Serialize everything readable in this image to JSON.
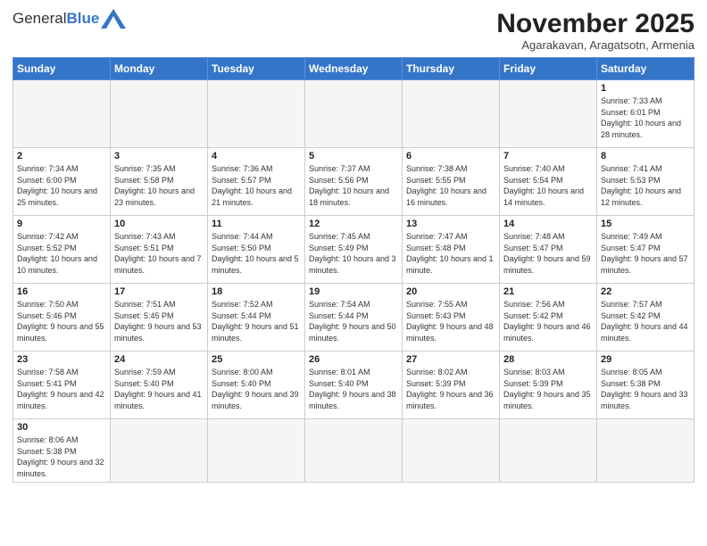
{
  "header": {
    "logo_general": "General",
    "logo_blue": "Blue",
    "month_title": "November 2025",
    "subtitle": "Agarakavan, Aragatsotn, Armenia"
  },
  "days_of_week": [
    "Sunday",
    "Monday",
    "Tuesday",
    "Wednesday",
    "Thursday",
    "Friday",
    "Saturday"
  ],
  "weeks": [
    [
      {
        "day": null,
        "info": null
      },
      {
        "day": null,
        "info": null
      },
      {
        "day": null,
        "info": null
      },
      {
        "day": null,
        "info": null
      },
      {
        "day": null,
        "info": null
      },
      {
        "day": null,
        "info": null
      },
      {
        "day": "1",
        "info": "Sunrise: 7:33 AM\nSunset: 6:01 PM\nDaylight: 10 hours\nand 28 minutes."
      }
    ],
    [
      {
        "day": "2",
        "info": "Sunrise: 7:34 AM\nSunset: 6:00 PM\nDaylight: 10 hours\nand 25 minutes."
      },
      {
        "day": "3",
        "info": "Sunrise: 7:35 AM\nSunset: 5:58 PM\nDaylight: 10 hours\nand 23 minutes."
      },
      {
        "day": "4",
        "info": "Sunrise: 7:36 AM\nSunset: 5:57 PM\nDaylight: 10 hours\nand 21 minutes."
      },
      {
        "day": "5",
        "info": "Sunrise: 7:37 AM\nSunset: 5:56 PM\nDaylight: 10 hours\nand 18 minutes."
      },
      {
        "day": "6",
        "info": "Sunrise: 7:38 AM\nSunset: 5:55 PM\nDaylight: 10 hours\nand 16 minutes."
      },
      {
        "day": "7",
        "info": "Sunrise: 7:40 AM\nSunset: 5:54 PM\nDaylight: 10 hours\nand 14 minutes."
      },
      {
        "day": "8",
        "info": "Sunrise: 7:41 AM\nSunset: 5:53 PM\nDaylight: 10 hours\nand 12 minutes."
      }
    ],
    [
      {
        "day": "9",
        "info": "Sunrise: 7:42 AM\nSunset: 5:52 PM\nDaylight: 10 hours\nand 10 minutes."
      },
      {
        "day": "10",
        "info": "Sunrise: 7:43 AM\nSunset: 5:51 PM\nDaylight: 10 hours\nand 7 minutes."
      },
      {
        "day": "11",
        "info": "Sunrise: 7:44 AM\nSunset: 5:50 PM\nDaylight: 10 hours\nand 5 minutes."
      },
      {
        "day": "12",
        "info": "Sunrise: 7:45 AM\nSunset: 5:49 PM\nDaylight: 10 hours\nand 3 minutes."
      },
      {
        "day": "13",
        "info": "Sunrise: 7:47 AM\nSunset: 5:48 PM\nDaylight: 10 hours\nand 1 minute."
      },
      {
        "day": "14",
        "info": "Sunrise: 7:48 AM\nSunset: 5:47 PM\nDaylight: 9 hours\nand 59 minutes."
      },
      {
        "day": "15",
        "info": "Sunrise: 7:49 AM\nSunset: 5:47 PM\nDaylight: 9 hours\nand 57 minutes."
      }
    ],
    [
      {
        "day": "16",
        "info": "Sunrise: 7:50 AM\nSunset: 5:46 PM\nDaylight: 9 hours\nand 55 minutes."
      },
      {
        "day": "17",
        "info": "Sunrise: 7:51 AM\nSunset: 5:45 PM\nDaylight: 9 hours\nand 53 minutes."
      },
      {
        "day": "18",
        "info": "Sunrise: 7:52 AM\nSunset: 5:44 PM\nDaylight: 9 hours\nand 51 minutes."
      },
      {
        "day": "19",
        "info": "Sunrise: 7:54 AM\nSunset: 5:44 PM\nDaylight: 9 hours\nand 50 minutes."
      },
      {
        "day": "20",
        "info": "Sunrise: 7:55 AM\nSunset: 5:43 PM\nDaylight: 9 hours\nand 48 minutes."
      },
      {
        "day": "21",
        "info": "Sunrise: 7:56 AM\nSunset: 5:42 PM\nDaylight: 9 hours\nand 46 minutes."
      },
      {
        "day": "22",
        "info": "Sunrise: 7:57 AM\nSunset: 5:42 PM\nDaylight: 9 hours\nand 44 minutes."
      }
    ],
    [
      {
        "day": "23",
        "info": "Sunrise: 7:58 AM\nSunset: 5:41 PM\nDaylight: 9 hours\nand 42 minutes."
      },
      {
        "day": "24",
        "info": "Sunrise: 7:59 AM\nSunset: 5:40 PM\nDaylight: 9 hours\nand 41 minutes."
      },
      {
        "day": "25",
        "info": "Sunrise: 8:00 AM\nSunset: 5:40 PM\nDaylight: 9 hours\nand 39 minutes."
      },
      {
        "day": "26",
        "info": "Sunrise: 8:01 AM\nSunset: 5:40 PM\nDaylight: 9 hours\nand 38 minutes."
      },
      {
        "day": "27",
        "info": "Sunrise: 8:02 AM\nSunset: 5:39 PM\nDaylight: 9 hours\nand 36 minutes."
      },
      {
        "day": "28",
        "info": "Sunrise: 8:03 AM\nSunset: 5:39 PM\nDaylight: 9 hours\nand 35 minutes."
      },
      {
        "day": "29",
        "info": "Sunrise: 8:05 AM\nSunset: 5:38 PM\nDaylight: 9 hours\nand 33 minutes."
      }
    ],
    [
      {
        "day": "30",
        "info": "Sunrise: 8:06 AM\nSunset: 5:38 PM\nDaylight: 9 hours\nand 32 minutes."
      },
      {
        "day": null,
        "info": null
      },
      {
        "day": null,
        "info": null
      },
      {
        "day": null,
        "info": null
      },
      {
        "day": null,
        "info": null
      },
      {
        "day": null,
        "info": null
      },
      {
        "day": null,
        "info": null
      }
    ]
  ]
}
